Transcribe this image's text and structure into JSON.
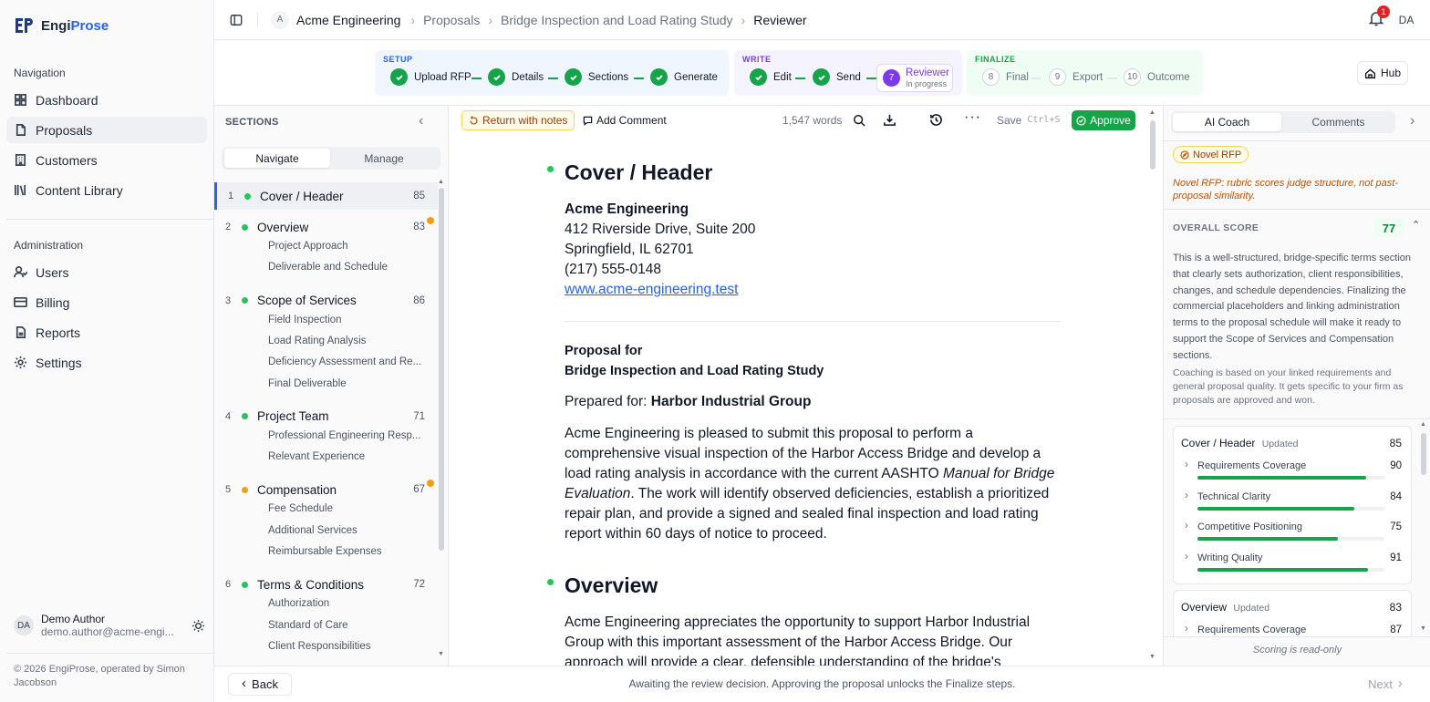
{
  "brand": {
    "name_a": "Engi",
    "name_b": "Prose"
  },
  "sidebar": {
    "nav_label": "Navigation",
    "nav": [
      {
        "label": "Dashboard",
        "icon": "dashboard-icon"
      },
      {
        "label": "Proposals",
        "icon": "document-icon",
        "active": true
      },
      {
        "label": "Customers",
        "icon": "building-icon"
      },
      {
        "label": "Content Library",
        "icon": "library-icon"
      }
    ],
    "admin_label": "Administration",
    "admin": [
      {
        "label": "Users",
        "icon": "users-icon"
      },
      {
        "label": "Billing",
        "icon": "card-icon"
      },
      {
        "label": "Reports",
        "icon": "reports-icon"
      },
      {
        "label": "Settings",
        "icon": "gear-icon"
      }
    ],
    "user": {
      "initials": "DA",
      "name": "Demo Author",
      "email": "demo.author@acme-engi..."
    },
    "copyright": "© 2026 EngiProse, operated by Simon Jacobson"
  },
  "header": {
    "org_initial": "A",
    "breadcrumbs": [
      "Acme Engineering",
      "Proposals",
      "Bridge Inspection and Load Rating Study",
      "Reviewer"
    ],
    "notification_count": "1",
    "user_initials": "DA"
  },
  "stepper": {
    "setup_label": "SETUP",
    "write_label": "WRITE",
    "finalize_label": "FINALIZE",
    "setup": [
      "Upload RFP",
      "Details",
      "Sections",
      "Generate"
    ],
    "write": [
      "Edit",
      "Send"
    ],
    "current": {
      "num": "7",
      "label": "Reviewer",
      "status": "In progress"
    },
    "finalize": [
      {
        "num": "8",
        "label": "Final"
      },
      {
        "num": "9",
        "label": "Export"
      },
      {
        "num": "10",
        "label": "Outcome"
      }
    ],
    "hub_label": "Hub"
  },
  "sections_panel": {
    "title": "SECTIONS",
    "tabs": [
      "Navigate",
      "Manage"
    ],
    "items": [
      {
        "num": "1",
        "label": "Cover / Header",
        "score": "85",
        "status": "green",
        "subs": []
      },
      {
        "num": "2",
        "label": "Overview",
        "score": "83",
        "status": "green",
        "flag": true,
        "subs": [
          "Project Approach",
          "Deliverable and Schedule"
        ]
      },
      {
        "num": "3",
        "label": "Scope of Services",
        "score": "86",
        "status": "green",
        "subs": [
          "Field Inspection",
          "Load Rating Analysis",
          "Deficiency Assessment and Re...",
          "Final Deliverable"
        ]
      },
      {
        "num": "4",
        "label": "Project Team",
        "score": "71",
        "status": "green",
        "subs": [
          "Professional Engineering Resp...",
          "Relevant Experience"
        ]
      },
      {
        "num": "5",
        "label": "Compensation",
        "score": "67",
        "status": "amber",
        "flag": true,
        "subs": [
          "Fee Schedule",
          "Additional Services",
          "Reimbursable Expenses"
        ]
      },
      {
        "num": "6",
        "label": "Terms & Conditions",
        "score": "72",
        "status": "green",
        "subs": [
          "Authorization",
          "Standard of Care",
          "Client Responsibilities"
        ]
      }
    ]
  },
  "toolbar": {
    "return_label": "Return with notes",
    "comment_label": "Add Comment",
    "word_count": "1,547 words",
    "save_label": "Save",
    "save_shortcut": "Ctrl+S",
    "approve_label": "Approve"
  },
  "document": {
    "h1": "Cover / Header",
    "company": "Acme Engineering",
    "address1": "412 Riverside Drive, Suite 200",
    "address2": "Springfield, IL 62701",
    "phone": "(217) 555-0148",
    "website": "www.acme-engineering.test",
    "proposal_for": "Proposal for",
    "project": "Bridge Inspection and Load Rating Study",
    "prepared_label": "Prepared for:",
    "client": "Harbor Industrial Group",
    "para1_a": "Acme Engineering is pleased to submit this proposal to perform a comprehensive visual inspection of the Harbor Access Bridge and develop a load rating analysis in accordance with the current AASHTO ",
    "para1_em": "Manual for Bridge Evaluation",
    "para1_b": ". The work will identify observed deficiencies, establish a prioritized repair plan, and provide a signed and sealed final inspection and load rating report within 60 days of notice to proceed.",
    "h2": "Overview",
    "para2": "Acme Engineering appreciates the opportunity to support Harbor Industrial Group with this important assessment of the Harbor Access Bridge. Our approach will provide a clear, defensible understanding of the bridge's"
  },
  "coach": {
    "tabs": [
      "AI Coach",
      "Comments"
    ],
    "badge": "Novel RFP",
    "novel_note": "Novel RFP: rubric scores judge structure, not past-proposal similarity.",
    "overall_label": "OVERALL SCORE",
    "overall_score": "77",
    "summary": "This is a well-structured, bridge-specific terms section that clearly sets authorization, client responsibilities, changes, and schedule dependencies. Finalizing the commercial placeholders and linking administration terms to the proposal schedule will make it ready to support the Scope of Services and Compensation sections.",
    "coaching_note": "Coaching is based on your linked requirements and general proposal quality. It gets specific to your firm as proposals are approved and won.",
    "cards": [
      {
        "title": "Cover / Header",
        "tag": "Updated",
        "score": "85",
        "metrics": [
          {
            "label": "Requirements Coverage",
            "score": 90
          },
          {
            "label": "Technical Clarity",
            "score": 84
          },
          {
            "label": "Competitive Positioning",
            "score": 75
          },
          {
            "label": "Writing Quality",
            "score": 91
          }
        ]
      },
      {
        "title": "Overview",
        "tag": "Updated",
        "score": "83",
        "metrics": [
          {
            "label": "Requirements Coverage",
            "score": 87
          }
        ]
      }
    ],
    "readonly": "Scoring is read-only"
  },
  "footer": {
    "back": "Back",
    "status": "Awaiting the review decision. Approving the proposal unlocks the Finalize steps.",
    "next": "Next"
  },
  "colors": {
    "accent": "#16a34a",
    "brand": "#2563eb",
    "amber": "#f59e0b",
    "purple": "#7c3aed"
  }
}
